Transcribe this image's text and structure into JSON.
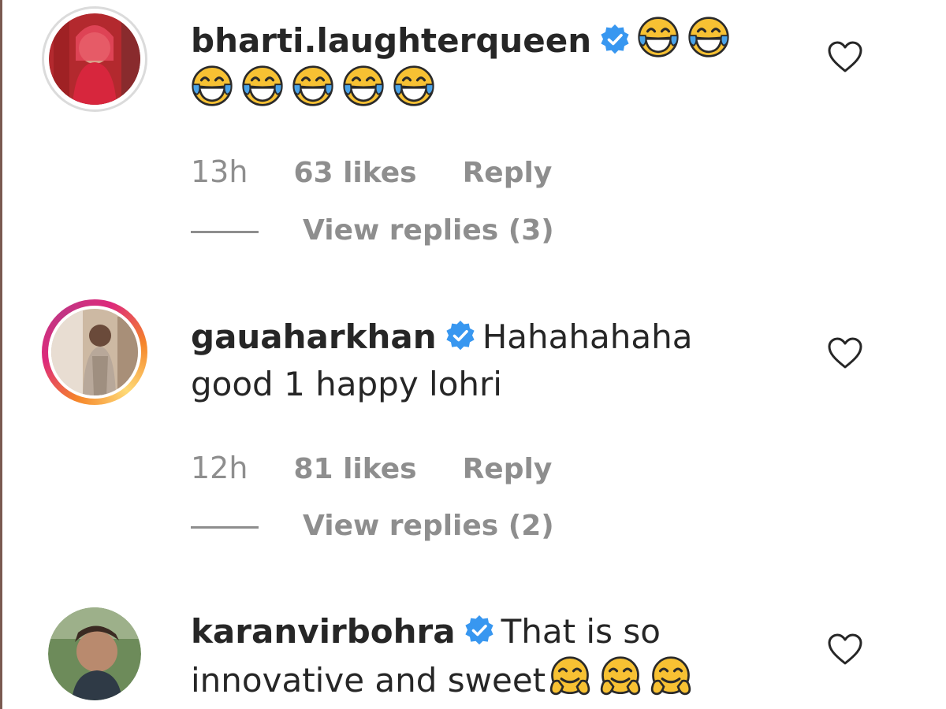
{
  "comments": [
    {
      "username": "bharti.laughterqueen",
      "verified": true,
      "text": "",
      "emoji": "face-with-tears-of-joy",
      "emoji_count": 7,
      "time": "13h",
      "likes": "63 likes",
      "reply": "Reply",
      "view_replies": "View replies (3)",
      "avatar_ring": "plain"
    },
    {
      "username": "gauaharkhan",
      "verified": true,
      "text": "Hahahahaha good 1 happy lohri",
      "time": "12h",
      "likes": "81 likes",
      "reply": "Reply",
      "view_replies": "View replies (2)",
      "avatar_ring": "story"
    },
    {
      "username": "karanvirbohra",
      "verified": true,
      "text": "That is so innovative and sweet",
      "emoji": "smiling-face-with-open-hands",
      "emoji_count": 3,
      "avatar_ring": "plain"
    }
  ],
  "colors": {
    "text": "#262626",
    "meta": "#8e8e8e",
    "verified_badge": "#3897f0",
    "story_ring_start": "#f58529",
    "story_ring_end": "#dd2a7b"
  },
  "icons": [
    "verified-badge-icon",
    "heart-outline-icon"
  ]
}
